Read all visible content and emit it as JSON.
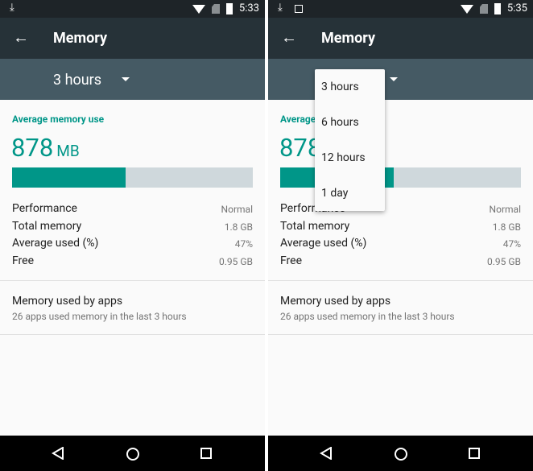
{
  "colors": {
    "accent": "#009688",
    "toolbar": "#263238",
    "spinner_bar": "#455a64",
    "bar_track": "#cfd8dc"
  },
  "screens": [
    {
      "status": {
        "time": "5:33",
        "icons": [
          "download-icon",
          "wifi-icon",
          "no-sim-icon",
          "battery-charging-icon"
        ]
      },
      "toolbar": {
        "title": "Memory",
        "back_icon": "arrow-back-icon"
      },
      "spinner": {
        "value": "3 hours"
      },
      "summary": {
        "label": "Average memory use",
        "value": "878",
        "unit": "MB",
        "usage_percent": 47
      },
      "stats": [
        {
          "label": "Performance",
          "value": "Normal"
        },
        {
          "label": "Total memory",
          "value": "1.8 GB"
        },
        {
          "label": "Average used (%)",
          "value": "47%"
        },
        {
          "label": "Free",
          "value": "0.95 GB"
        }
      ],
      "apps": {
        "title": "Memory used by apps",
        "subtitle": "26 apps used memory in the last 3 hours"
      }
    },
    {
      "status": {
        "time": "5:35",
        "icons": [
          "download-icon",
          "image-icon",
          "wifi-icon",
          "no-sim-icon",
          "battery-charging-icon"
        ]
      },
      "toolbar": {
        "title": "Memory",
        "back_icon": "arrow-back-icon"
      },
      "spinner": {
        "value": "3 hours"
      },
      "summary": {
        "label": "Average memory use",
        "value": "878",
        "unit": "MB",
        "usage_percent": 47
      },
      "stats": [
        {
          "label": "Performance",
          "value": "Normal"
        },
        {
          "label": "Total memory",
          "value": "1.8 GB"
        },
        {
          "label": "Average used (%)",
          "value": "47%"
        },
        {
          "label": "Free",
          "value": "0.95 GB"
        }
      ],
      "apps": {
        "title": "Memory used by apps",
        "subtitle": "26 apps used memory in the last 3 hours"
      },
      "dropdown": {
        "options": [
          "3 hours",
          "6 hours",
          "12 hours",
          "1 day"
        ]
      }
    }
  ]
}
